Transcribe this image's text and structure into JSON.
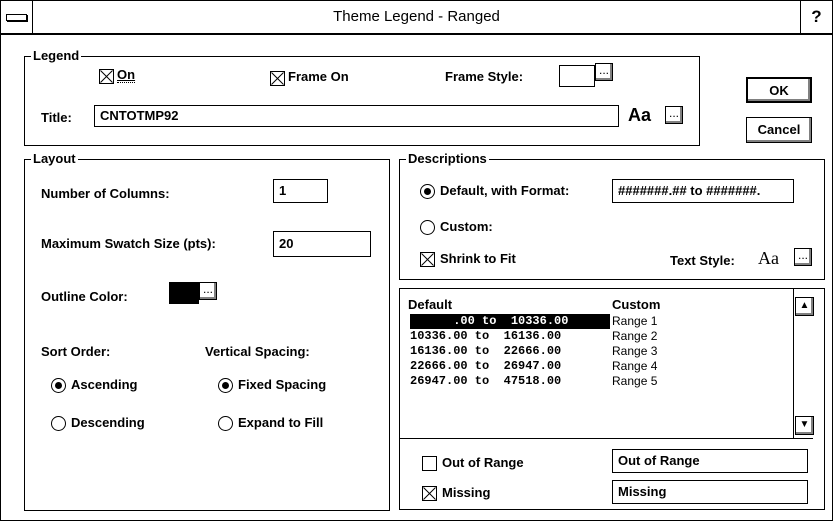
{
  "window": {
    "title": "Theme Legend - Ranged",
    "help": "?"
  },
  "legend": {
    "group_title": "Legend",
    "on_label": "On",
    "frame_on_label": "Frame On",
    "frame_style_label": "Frame Style:",
    "title_label": "Title:",
    "title_value": "CNTOTMP92",
    "font_sample": "Aa",
    "on_checked": true,
    "frame_on_checked": true
  },
  "buttons": {
    "ok": "OK",
    "cancel": "Cancel",
    "ellipsis": "..."
  },
  "layout": {
    "group_title": "Layout",
    "num_columns_label": "Number of Columns:",
    "num_columns_value": "1",
    "max_swatch_label": "Maximum Swatch Size (pts):",
    "max_swatch_value": "20",
    "outline_color_label": "Outline Color:",
    "outline_color": "#000000",
    "sort_order_label": "Sort Order:",
    "vertical_spacing_label": "Vertical Spacing:",
    "ascending": "Ascending",
    "descending": "Descending",
    "fixed_spacing": "Fixed Spacing",
    "expand_to_fill": "Expand to Fill",
    "sort_selected": "Ascending",
    "spacing_selected": "Fixed Spacing"
  },
  "descriptions": {
    "group_title": "Descriptions",
    "default_with_format": "Default, with Format:",
    "format_value": "#######.## to #######.",
    "custom": "Custom:",
    "shrink_to_fit": "Shrink to Fit",
    "text_style_label": "Text Style:",
    "text_style_sample": "Aa",
    "selected": "Default, with Format:",
    "shrink_checked": true
  },
  "ranges": {
    "col_default": "Default",
    "col_custom": "Custom",
    "rows": [
      {
        "default": "      .00 to  10336.00",
        "custom": "Range 1",
        "selected": true
      },
      {
        "default": "10336.00 to  16136.00",
        "custom": "Range 2",
        "selected": false
      },
      {
        "default": "16136.00 to  22666.00",
        "custom": "Range 3",
        "selected": false
      },
      {
        "default": "22666.00 to  26947.00",
        "custom": "Range 4",
        "selected": false
      },
      {
        "default": "26947.00 to  47518.00",
        "custom": "Range 5",
        "selected": false
      }
    ],
    "scroll_up": "▲",
    "scroll_down": "▼",
    "out_of_range_label": "Out of Range",
    "out_of_range_value": "Out of Range",
    "out_of_range_checked": false,
    "missing_label": "Missing",
    "missing_value": "Missing",
    "missing_checked": true
  }
}
